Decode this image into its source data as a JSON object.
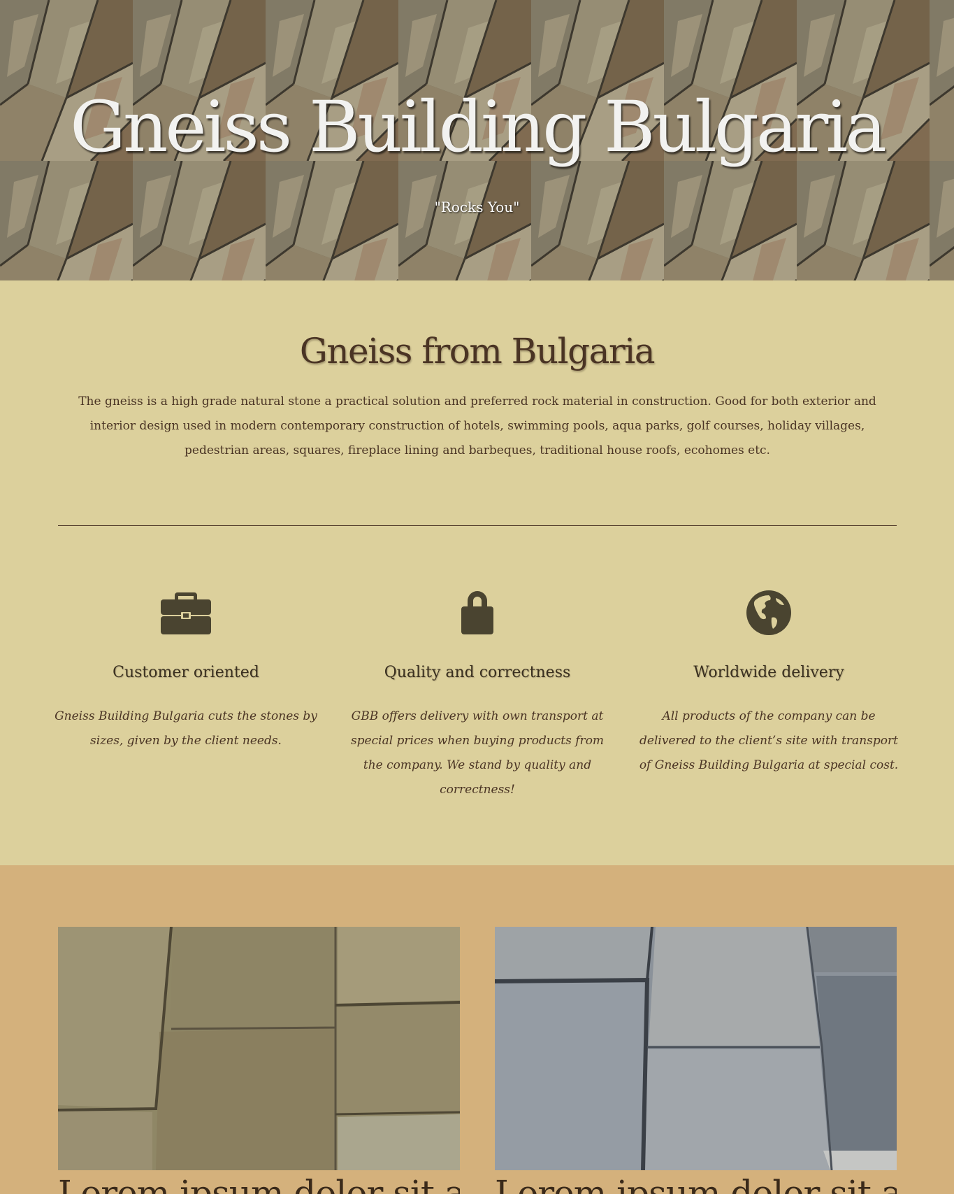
{
  "hero": {
    "title": "Gneiss Building Bulgaria",
    "tagline": "\"Rocks You\""
  },
  "about": {
    "title": "Gneiss from Bulgaria",
    "text": "The gneiss is a high grade natural stone a practical solution and preferred rock material in construction. Good for both exterior and interior design used in modern contemporary construction of hotels, swimming pools, aqua parks, golf courses, holiday villages, pedestrian areas, squares, fireplace lining and barbeques, traditional house roofs, ecohomes etc."
  },
  "features": [
    {
      "icon": "briefcase-icon",
      "title": "Customer oriented",
      "text": "Gneiss Building Bulgaria cuts the stones by sizes, given by the client needs."
    },
    {
      "icon": "lock-icon",
      "title": "Quality and correctness",
      "text": "GBB offers delivery with own transport at special prices when buying products from the company. We stand by quality and correctness!"
    },
    {
      "icon": "globe-icon",
      "title": "Worldwide delivery",
      "text": "All products of the company can be delivered to the client’s site with transport of Gneiss Building Bulgaria at special cost."
    }
  ],
  "gallery": [
    {
      "caption": "Lorem ipsum dolor sit amet"
    },
    {
      "caption": "Lorem ipsum dolor sit amet"
    }
  ],
  "colors": {
    "section_bg": "#dcd09c",
    "gallery_bg": "#d4b17c",
    "text": "#4a3424",
    "icon": "#4a4430"
  }
}
